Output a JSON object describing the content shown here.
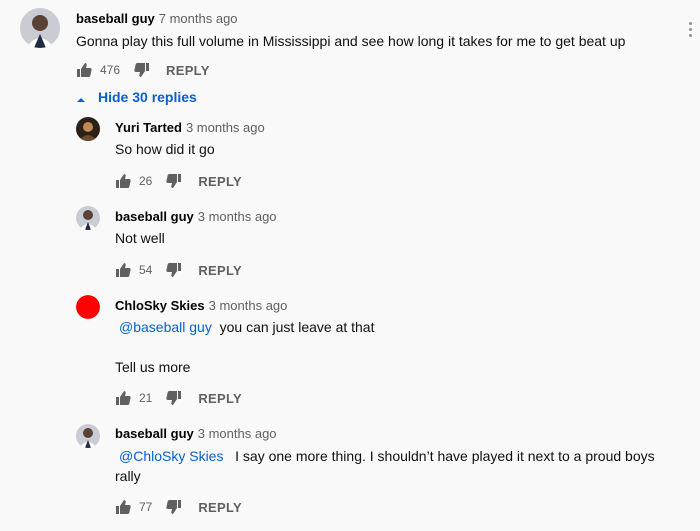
{
  "top_comment": {
    "author": "baseball guy",
    "time": "7 months ago",
    "text": "Gonna play this full volume in Mississippi and see how long it takes for me to get beat up",
    "likes": "476",
    "reply_label": "REPLY",
    "menu_icon": "more-vert-icon"
  },
  "hide_replies_label": "Hide 30 replies",
  "replies": [
    {
      "author": "Yuri Tarted",
      "time": "3 months ago",
      "text": "So how did it go",
      "likes": "26",
      "reply_label": "REPLY"
    },
    {
      "author": "baseball guy",
      "time": "3 months ago",
      "text": "Not well",
      "likes": "54",
      "reply_label": "REPLY"
    },
    {
      "author": "ChloSky Skies",
      "time": "3 months ago",
      "mention": "@baseball guy",
      "text_after_mention": "you can just leave at that",
      "text_line2": "Tell us more",
      "likes": "21",
      "reply_label": "REPLY"
    },
    {
      "author": "baseball guy",
      "time": "3 months ago",
      "mention": "@ChloSky Skies",
      "text_after_mention": "I say one more thing. I shouldn’t have played it next to a proud boys",
      "text_line2": "rally",
      "likes": "77",
      "reply_label": "REPLY"
    }
  ],
  "colors": {
    "link": "#065fd4",
    "red_avatar": "#ff0000",
    "meta": "#606060"
  },
  "icons": {
    "like": "thumbs-up-icon",
    "dislike": "thumbs-down-icon",
    "chevron": "chevron-up-icon"
  }
}
